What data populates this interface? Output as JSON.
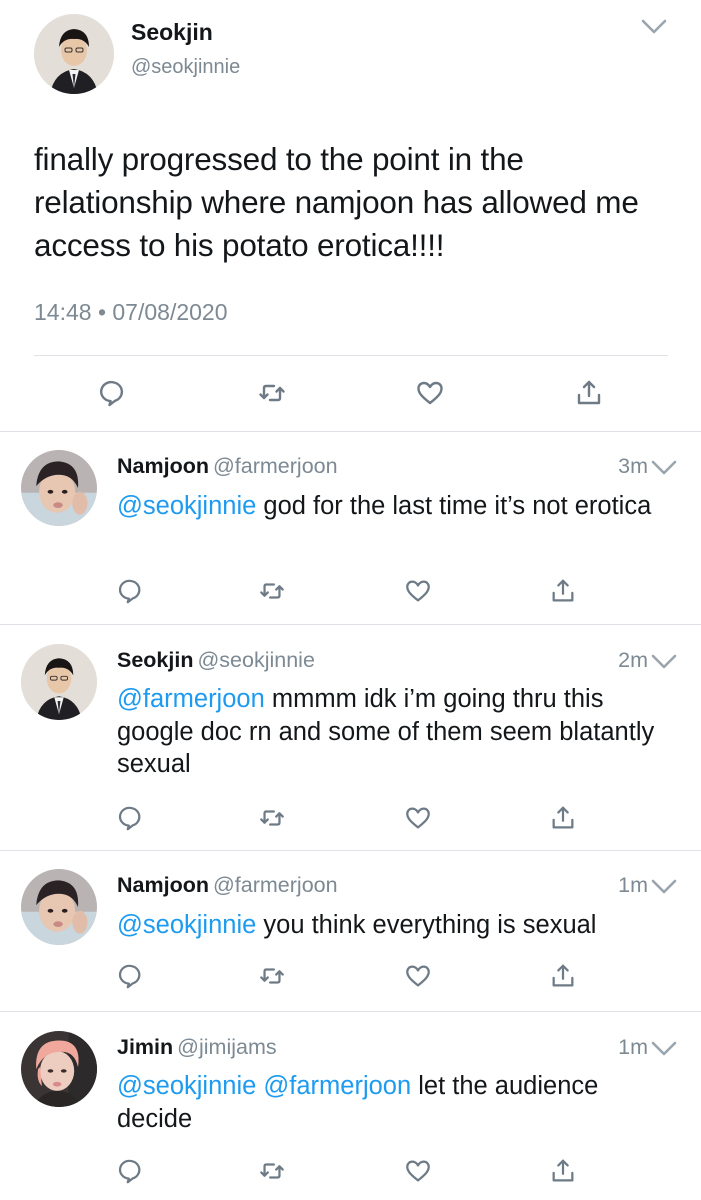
{
  "main_tweet": {
    "author_name": "Seokjin",
    "author_handle": "@seokjinnie",
    "text": "finally progressed to the point in the relationship where namjoon has allowed me access to his potato erotica!!!!",
    "timestamp": "14:48 • 07/08/2020",
    "actions": [
      "reply-icon",
      "retweet-icon",
      "like-icon",
      "share-icon"
    ]
  },
  "replies": [
    {
      "name": "Namjoon",
      "handle": "@farmerjoon",
      "age": "3m",
      "mention": "@seokjinnie",
      "text": " god for the last time it’s not erotica",
      "avatar": "namjoon"
    },
    {
      "name": "Seokjin",
      "handle": "@seokjinnie",
      "age": "2m",
      "mention": "@farmerjoon",
      "text": " mmmm idk i’m going thru this google doc rn and some of them seem blatantly sexual",
      "avatar": "seokjin"
    },
    {
      "name": "Namjoon",
      "handle": "@farmerjoon",
      "age": "1m",
      "mention": "@seokjinnie",
      "text": " you think everything is sexual",
      "avatar": "namjoon"
    },
    {
      "name": "Jimin",
      "handle": "@jimijams",
      "age": "1m",
      "mention": "@seokjinnie",
      "mention2": "@farmerjoon",
      "text": " let the audience decide",
      "avatar": "jimin"
    }
  ],
  "colors": {
    "mention": "#1d9bf0",
    "secondary_text": "#7d8993",
    "icon": "#6e7b86",
    "divider": "#dfe3e7"
  }
}
